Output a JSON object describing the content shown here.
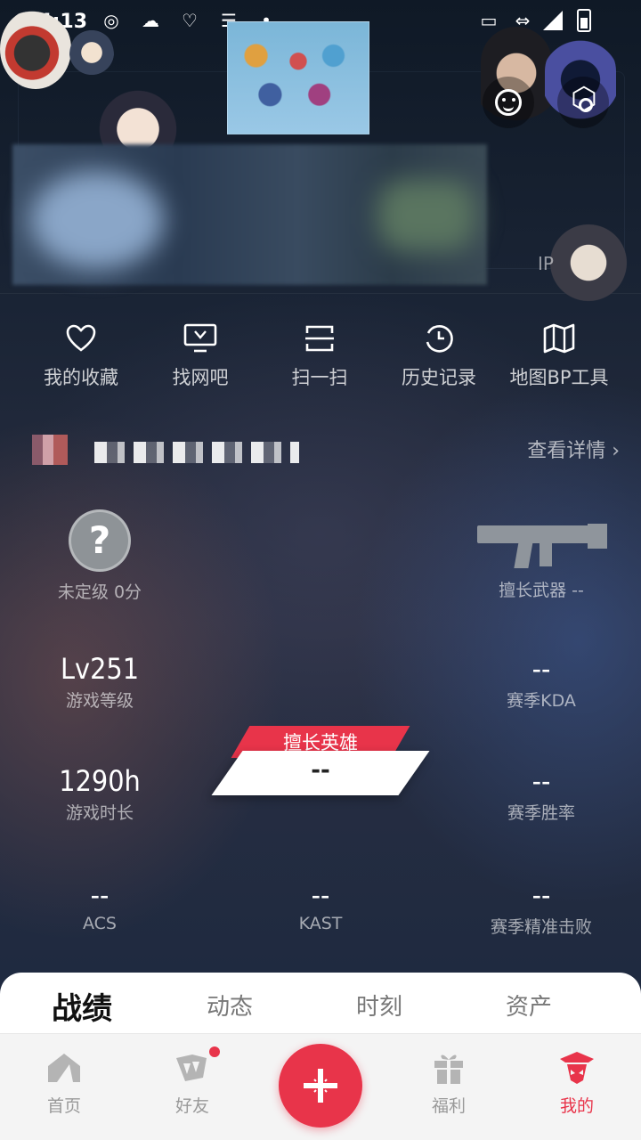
{
  "status_bar": {
    "time": "14:13"
  },
  "banner": {
    "ip_label": "IP"
  },
  "quick_actions": [
    {
      "label": "我的收藏",
      "icon": "heart-icon"
    },
    {
      "label": "找网吧",
      "icon": "monitor-icon"
    },
    {
      "label": "扫一扫",
      "icon": "scan-icon"
    },
    {
      "label": "历史记录",
      "icon": "history-icon"
    },
    {
      "label": "地图BP工具",
      "icon": "map-icon"
    }
  ],
  "profile": {
    "view_details": "查看详情 ›"
  },
  "stats": {
    "rank_symbol": "?",
    "rank": "未定级 0分",
    "weapon_label": "擅长武器 --",
    "level_value": "Lv251",
    "level_label": "游戏等级",
    "kda_value": "--",
    "kda_label": "赛季KDA",
    "playtime_value": "1290h",
    "playtime_label": "游戏时长",
    "winrate_value": "--",
    "winrate_label": "赛季胜率",
    "hero_tag": "擅长英雄",
    "hero_value": "--",
    "acs_value": "--",
    "acs_label": "ACS",
    "kast_value": "--",
    "kast_label": "KAST",
    "hs_value": "--",
    "hs_label": "赛季精准击败"
  },
  "tabs": [
    "战绩",
    "动态",
    "时刻",
    "资产"
  ],
  "bottom_nav": [
    {
      "label": "首页",
      "icon": "home-icon"
    },
    {
      "label": "好友",
      "icon": "friends-icon"
    },
    {
      "label": "福利",
      "icon": "gift-icon"
    },
    {
      "label": "我的",
      "icon": "profile-icon"
    }
  ],
  "colors": {
    "accent": "#e8344a"
  }
}
